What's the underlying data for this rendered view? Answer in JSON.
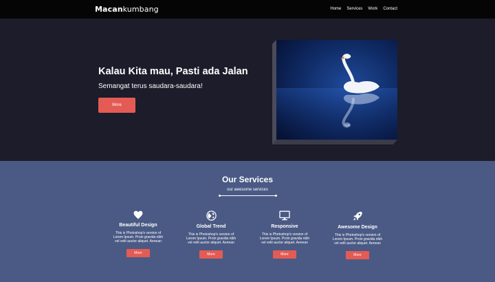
{
  "navbar": {
    "brand_bold": "Macan",
    "brand_light": "kumbang",
    "links": [
      {
        "label": "Home"
      },
      {
        "label": "Services"
      },
      {
        "label": "Work"
      },
      {
        "label": "Contact"
      }
    ]
  },
  "hero": {
    "title": "Kalau Kita mau, Pasti ada Jalan",
    "subtitle": "Semangat terus saudara-saudara!",
    "button_label": "More",
    "image_subject": "swan-photo"
  },
  "services": {
    "title": "Our Services",
    "subtitle": "our awesome services",
    "items": [
      {
        "icon": "heart-icon",
        "title": "Beautiful Design",
        "desc": "This is Photoshop's version of Lorem Ipsum. Proin gravida nibh vel velit auctor aliquet. Aenean",
        "button_label": "More"
      },
      {
        "icon": "globe-icon",
        "title": "Global Trend",
        "desc": "This is Photoshop's version of Lorem Ipsum. Proin gravida nibh vel velit auctor aliquet. Aenean",
        "button_label": "More"
      },
      {
        "icon": "monitor-icon",
        "title": "Responsive",
        "desc": "This is Photoshop's version of Lorem Ipsum. Proin gravida nibh vel velit auctor aliquet. Aenean",
        "button_label": "More"
      },
      {
        "icon": "rocket-icon",
        "title": "Awesome Design",
        "desc": "This is Photoshop's version of Lorem Ipsum. Proin gravida nibh vel velit auctor aliquet. Aenean",
        "button_label": "More"
      }
    ]
  },
  "colors": {
    "navbar_bg": "#050506",
    "hero_bg": "#1c1c2a",
    "services_bg": "#4a5a85",
    "accent": "#e35b54"
  }
}
